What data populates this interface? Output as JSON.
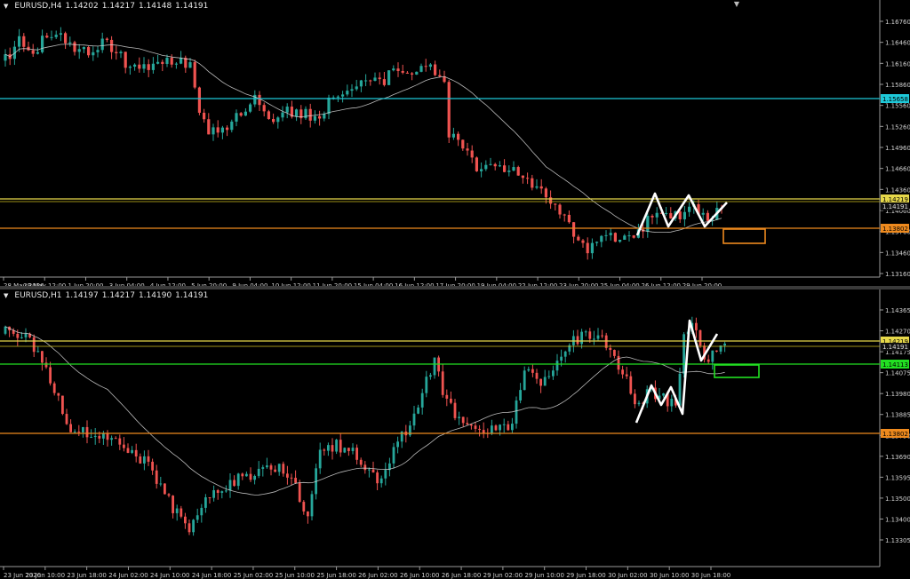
{
  "panels": {
    "top": {
      "symbol": "EURUSD,H4",
      "ohlc": [
        "1.14202",
        "1.14217",
        "1.14148",
        "1.14191"
      ],
      "price_axis": [
        "1.16760",
        "1.16460",
        "1.16160",
        "1.15860",
        "1.15560",
        "1.15260",
        "1.14960",
        "1.14660",
        "1.14360",
        "1.14060",
        "1.13760",
        "1.13460",
        "1.13160"
      ],
      "time_axis": [
        "28 May 2026",
        "29 May 12:00",
        "1 Jun 20:00",
        "3 Jun 04:00",
        "4 Jun 12:00",
        "5 Jun 20:00",
        "9 Jun 04:00",
        "10 Jun 12:00",
        "11 Jun 20:00",
        "15 Jun 04:00",
        "16 Jun 12:00",
        "17 Jun 20:00",
        "19 Jun 04:00",
        "22 Jun 12:00",
        "23 Jun 20:00",
        "25 Jun 04:00",
        "26 Jun 12:00",
        "29 Jun 20:00"
      ],
      "levels": [
        {
          "label": "1.15658",
          "color": "#1ec8d8",
          "text_color": "#000"
        },
        {
          "label": "1.14219",
          "color": "#e6d84a",
          "text_color": "#000"
        },
        {
          "label": "1.13802",
          "color": "#ee8a1e",
          "text_color": "#000"
        }
      ],
      "grey_label": "1.14191"
    },
    "bottom": {
      "symbol": "EURUSD,H1",
      "ohlc": [
        "1.14197",
        "1.14217",
        "1.14190",
        "1.14191"
      ],
      "price_axis": [
        "1.14365",
        "1.14270",
        "1.14175",
        "1.14075",
        "1.13980",
        "1.13885",
        "1.13790",
        "1.13690",
        "1.13595",
        "1.13500",
        "1.13400",
        "1.13305"
      ],
      "time_axis": [
        "23 Jun 2026",
        "23 Jun 10:00",
        "23 Jun 18:00",
        "24 Jun 02:00",
        "24 Jun 10:00",
        "24 Jun 18:00",
        "25 Jun 02:00",
        "25 Jun 10:00",
        "25 Jun 18:00",
        "26 Jun 02:00",
        "26 Jun 10:00",
        "26 Jun 18:00",
        "29 Jun 02:00",
        "29 Jun 10:00",
        "29 Jun 18:00",
        "30 Jun 02:00",
        "30 Jun 10:00",
        "30 Jun 18:00"
      ],
      "levels": [
        {
          "label": "1.14219",
          "color": "#e6d84a",
          "text_color": "#000"
        },
        {
          "label": "1.14113",
          "color": "#22e022",
          "text_color": "#000"
        },
        {
          "label": "1.13802",
          "color": "#ee8a1e",
          "text_color": "#000"
        }
      ],
      "grey_label": "1.14191"
    }
  },
  "colors": {
    "bull": "#26a69a",
    "bear": "#ef5350",
    "ma": "#d8d8d8",
    "axis_text": "#d0d0d0",
    "pattern": "#ffffff"
  }
}
